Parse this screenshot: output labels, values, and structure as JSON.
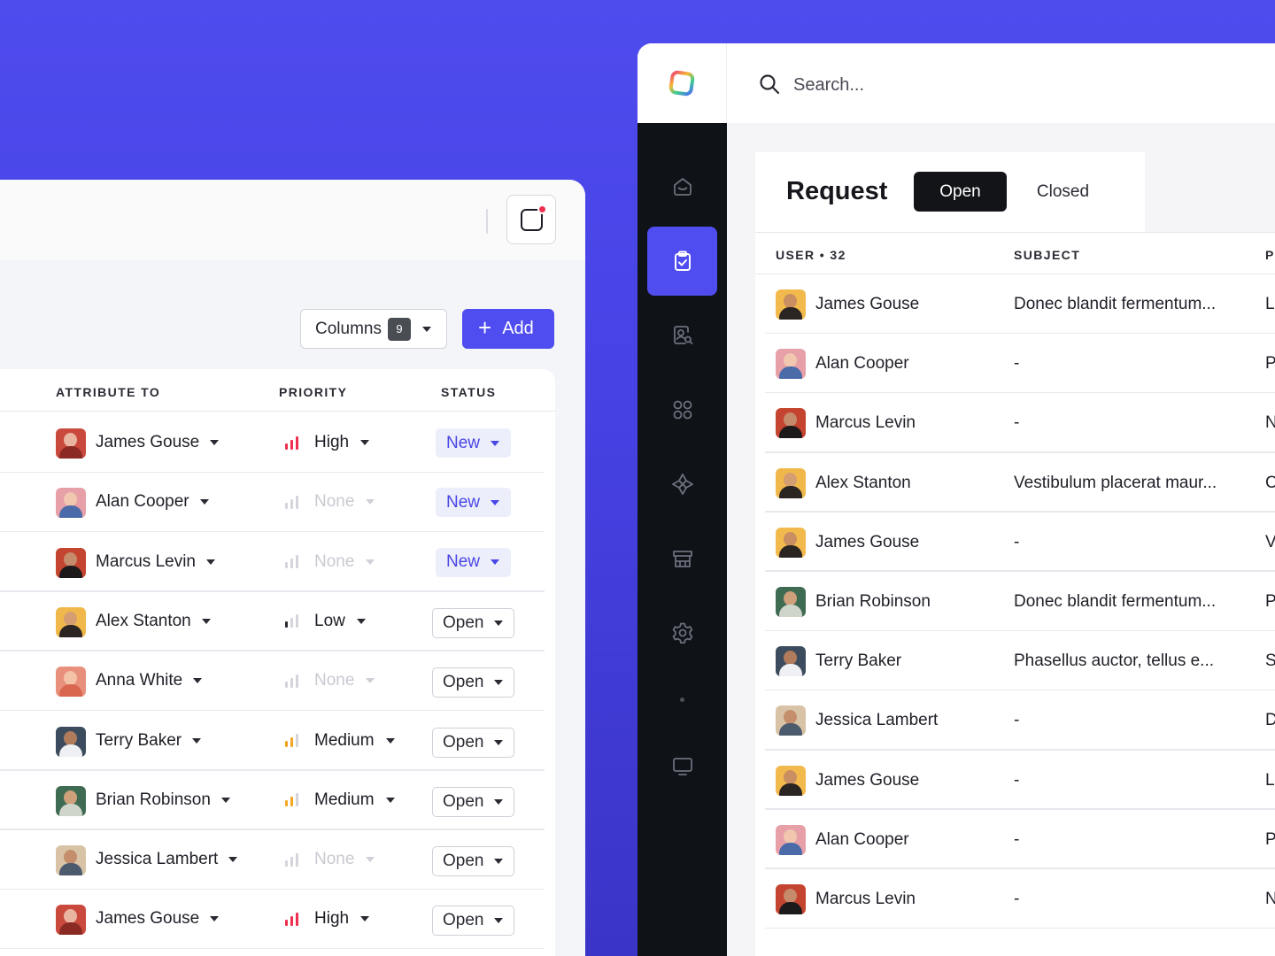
{
  "left_panel": {
    "toolbar": {
      "columns_label": "Columns",
      "columns_count": "9",
      "add_label": "Add"
    },
    "table": {
      "headers": {
        "attribute_to": "ATTRIBUTE TO",
        "priority": "PRIORITY",
        "status": "STATUS"
      },
      "rows": [
        {
          "name": "James Gouse",
          "priority": "High",
          "priority_level": "high",
          "status": "New"
        },
        {
          "name": "Alan Cooper",
          "priority": "None",
          "priority_level": "none",
          "status": "New"
        },
        {
          "name": "Marcus Levin",
          "priority": "None",
          "priority_level": "none",
          "status": "New"
        },
        {
          "name": "Alex Stanton",
          "priority": "Low",
          "priority_level": "low",
          "status": "Open"
        },
        {
          "name": "Anna White",
          "priority": "None",
          "priority_level": "none",
          "status": "Open"
        },
        {
          "name": "Terry Baker",
          "priority": "Medium",
          "priority_level": "medium",
          "status": "Open"
        },
        {
          "name": "Brian Robinson",
          "priority": "Medium",
          "priority_level": "medium",
          "status": "Open"
        },
        {
          "name": "Jessica Lambert",
          "priority": "None",
          "priority_level": "none",
          "status": "Open"
        },
        {
          "name": "James Gouse",
          "priority": "High",
          "priority_level": "high",
          "status": "Open"
        }
      ]
    }
  },
  "right_app": {
    "search": {
      "placeholder": "Search..."
    },
    "sidebar": {
      "items": [
        {
          "icon": "inbox-icon",
          "active": false
        },
        {
          "icon": "clipboard-check-icon",
          "active": true
        },
        {
          "icon": "user-search-icon",
          "active": false
        },
        {
          "icon": "grid-icon",
          "active": false
        },
        {
          "icon": "network-icon",
          "active": false
        },
        {
          "icon": "store-icon",
          "active": false
        },
        {
          "icon": "settings-icon",
          "active": false
        },
        {
          "icon": "monitor-icon",
          "active": false
        }
      ]
    },
    "header": {
      "title": "Request",
      "tab_open": "Open",
      "tab_closed": "Closed"
    },
    "table": {
      "headers": {
        "user": "USER • 32",
        "subject": "SUBJECT",
        "p": "P"
      },
      "rows": [
        {
          "name": "James Gouse",
          "subject": "Donec blandit fermentum...",
          "p": "L"
        },
        {
          "name": "Alan Cooper",
          "subject": "-",
          "p": "P"
        },
        {
          "name": "Marcus Levin",
          "subject": "-",
          "p": "N"
        },
        {
          "name": "Alex Stanton",
          "subject": "Vestibulum placerat maur...",
          "p": "C"
        },
        {
          "name": "James Gouse",
          "subject": "-",
          "p": "V"
        },
        {
          "name": "Brian Robinson",
          "subject": "Donec blandit fermentum...",
          "p": "P"
        },
        {
          "name": "Terry Baker",
          "subject": "Phasellus auctor, tellus e...",
          "p": "S"
        },
        {
          "name": "Jessica Lambert",
          "subject": "-",
          "p": "D"
        },
        {
          "name": "James Gouse",
          "subject": "-",
          "p": "L"
        },
        {
          "name": "Alan Cooper",
          "subject": "-",
          "p": "P"
        },
        {
          "name": "Marcus Levin",
          "subject": "-",
          "p": "N"
        }
      ]
    }
  },
  "colors": {
    "background": "#4f4cee",
    "accent": "#4f4cf0",
    "sidebar": "#0f1217",
    "priority_high": "#ee2f4f",
    "priority_medium": "#f5a524",
    "priority_low": "#2a2a33",
    "priority_none": "#d4d5dc",
    "notification": "#ee2f4f"
  }
}
